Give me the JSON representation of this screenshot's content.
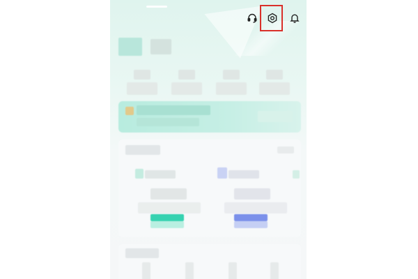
{
  "app": {
    "top_bar": {
      "icons": [
        "headset-icon",
        "settings-icon",
        "bell-icon"
      ],
      "highlighted": "settings-icon"
    },
    "colors": {
      "highlight": "#d9302a",
      "accent_green": "#35d2b0",
      "accent_blue": "#7b90ea",
      "banner_bg": "#c6efe5"
    }
  }
}
